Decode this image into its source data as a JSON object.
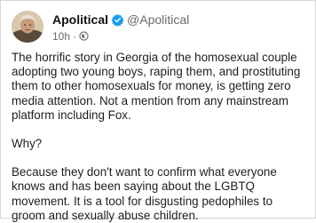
{
  "post": {
    "author": {
      "display_name": "Apolitical",
      "handle": "@Apolitical",
      "verified": true,
      "avatar_icon": "avatar-portrait"
    },
    "timestamp": "10h",
    "separator": "·",
    "visibility_icon": "globe-icon",
    "body": {
      "paragraph_1": "The horrific story in Georgia of the homosexual couple\nadopting two young boys, raping them, and prostituting\nthem to other homosexuals for money, is getting zero\nmedia attention. Not a mention from any mainstream\nplatform including Fox.",
      "paragraph_2": "Why?",
      "paragraph_3": "Because they don't want to confirm what everyone\nknows and has been saying about the LGBTQ\nmovement. It is a tool for disgusting pedophiles to\ngroom and sexually abuse children."
    }
  },
  "colors": {
    "verified_badge": "#1d9bf0",
    "muted_text": "#6a6a6a",
    "border": "#d6d6d6"
  }
}
